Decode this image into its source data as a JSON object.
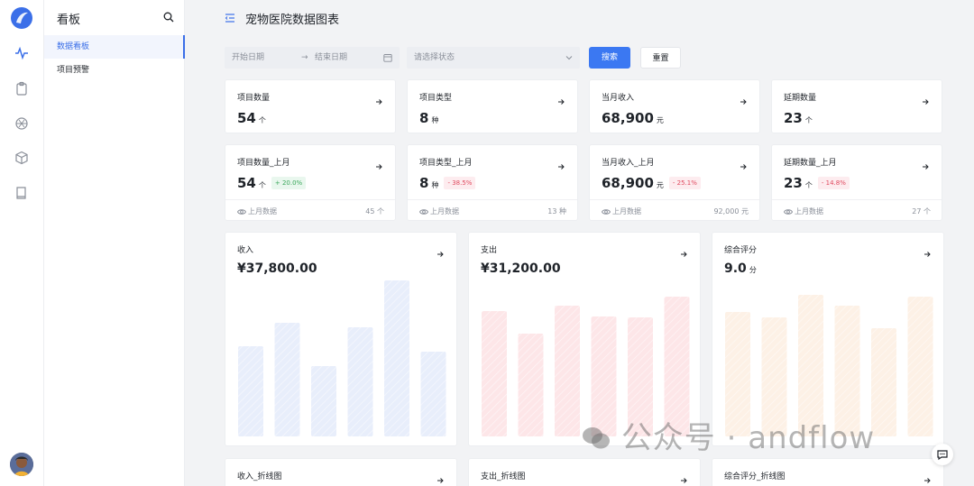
{
  "nav": {
    "title": "看板",
    "items": [
      {
        "label": "数据看板",
        "active": true
      },
      {
        "label": "项目预警",
        "active": false
      }
    ]
  },
  "rail_icons": [
    "activity-icon",
    "clipboard-icon",
    "aperture-icon",
    "box-icon",
    "book-icon"
  ],
  "header": {
    "title": "宠物医院数据图表"
  },
  "filters": {
    "start_placeholder": "开始日期",
    "arrow": "→",
    "end_placeholder": "结束日期",
    "status_placeholder": "请选择状态",
    "search_label": "搜索",
    "reset_label": "重置"
  },
  "summary": [
    {
      "label": "项目数量",
      "value": "54",
      "unit": "个"
    },
    {
      "label": "项目类型",
      "value": "8",
      "unit": "种"
    },
    {
      "label": "当月收入",
      "value": "68,900",
      "unit": "元"
    },
    {
      "label": "延期数量",
      "value": "23",
      "unit": "个"
    }
  ],
  "compare": [
    {
      "label": "项目数量_上月",
      "value": "54",
      "unit": "个",
      "badge": "+ 20.0%",
      "trend": "up",
      "foot_label": "上月数据",
      "foot_value": "45 个"
    },
    {
      "label": "项目类型_上月",
      "value": "8",
      "unit": "种",
      "badge": "- 38.5%",
      "trend": "down",
      "foot_label": "上月数据",
      "foot_value": "13 种"
    },
    {
      "label": "当月收入_上月",
      "value": "68,900",
      "unit": "元",
      "badge": "- 25.1%",
      "trend": "down",
      "foot_label": "上月数据",
      "foot_value": "92,000 元"
    },
    {
      "label": "延期数量_上月",
      "value": "23",
      "unit": "个",
      "badge": "- 14.8%",
      "trend": "down",
      "foot_label": "上月数据",
      "foot_value": "27 个"
    }
  ],
  "charts": [
    {
      "label": "收入",
      "value": "¥37,800.00",
      "unit": "",
      "color": "#e8eefb"
    },
    {
      "label": "支出",
      "value": "¥31,200.00",
      "unit": "",
      "color": "#fde6e8"
    },
    {
      "label": "综合评分",
      "value": "9.0",
      "unit": "分",
      "color": "#fdf1e6"
    }
  ],
  "chart_data": [
    {
      "type": "bar",
      "title": "收入",
      "values": [
        100,
        126,
        78,
        121,
        173,
        94
      ]
    },
    {
      "type": "bar",
      "title": "支出",
      "values": [
        139,
        114,
        145,
        133,
        132,
        155
      ]
    },
    {
      "type": "bar",
      "title": "综合评分",
      "values": [
        138,
        132,
        157,
        145,
        120,
        155
      ]
    }
  ],
  "bottom_cards": [
    {
      "label": "收入_折线图"
    },
    {
      "label": "支出_折线图"
    },
    {
      "label": "综合评分_折线图"
    }
  ],
  "watermark": "公众号 · andflow"
}
